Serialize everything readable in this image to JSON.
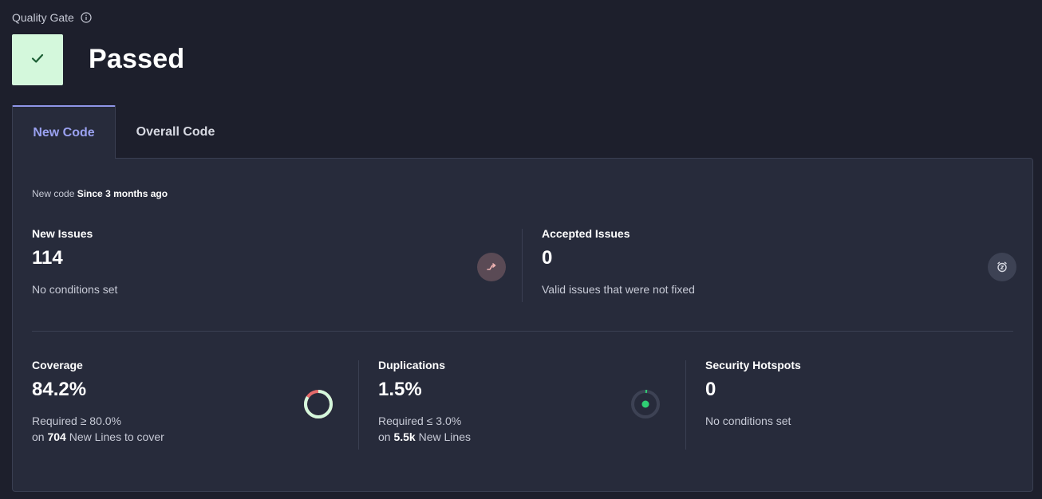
{
  "quality_gate": {
    "label": "Quality Gate",
    "status": "Passed",
    "status_color": "#d4f8dc",
    "status_icon": "check-icon"
  },
  "tabs": [
    {
      "label": "New Code",
      "active": true
    },
    {
      "label": "Overall Code",
      "active": false
    }
  ],
  "new_code": {
    "prefix": "New code",
    "since": "Since 3 months ago"
  },
  "issues": {
    "new": {
      "title": "New Issues",
      "value": "114",
      "sub": "No conditions set",
      "icon": "trend-arrow-icon"
    },
    "accepted": {
      "title": "Accepted Issues",
      "value": "0",
      "sub": "Valid issues that were not fixed",
      "icon": "alarm-clock-icon"
    }
  },
  "metrics": {
    "coverage": {
      "title": "Coverage",
      "value": "84.2%",
      "required": "Required ≥ 80.0%",
      "on_prefix": "on",
      "on_count": "704",
      "on_suffix": "New Lines to cover",
      "gauge_fraction": 0.842
    },
    "duplications": {
      "title": "Duplications",
      "value": "1.5%",
      "required": "Required ≤ 3.0%",
      "on_prefix": "on",
      "on_count": "5.5k",
      "on_suffix": "New Lines",
      "gauge_fraction": 0.015
    },
    "hotspots": {
      "title": "Security Hotspots",
      "value": "0",
      "sub": "No conditions set"
    }
  },
  "colors": {
    "accent": "#8f95e8",
    "success": "#d4f8dc",
    "success_dot": "#2fcf74",
    "danger": "#e56b6b"
  }
}
